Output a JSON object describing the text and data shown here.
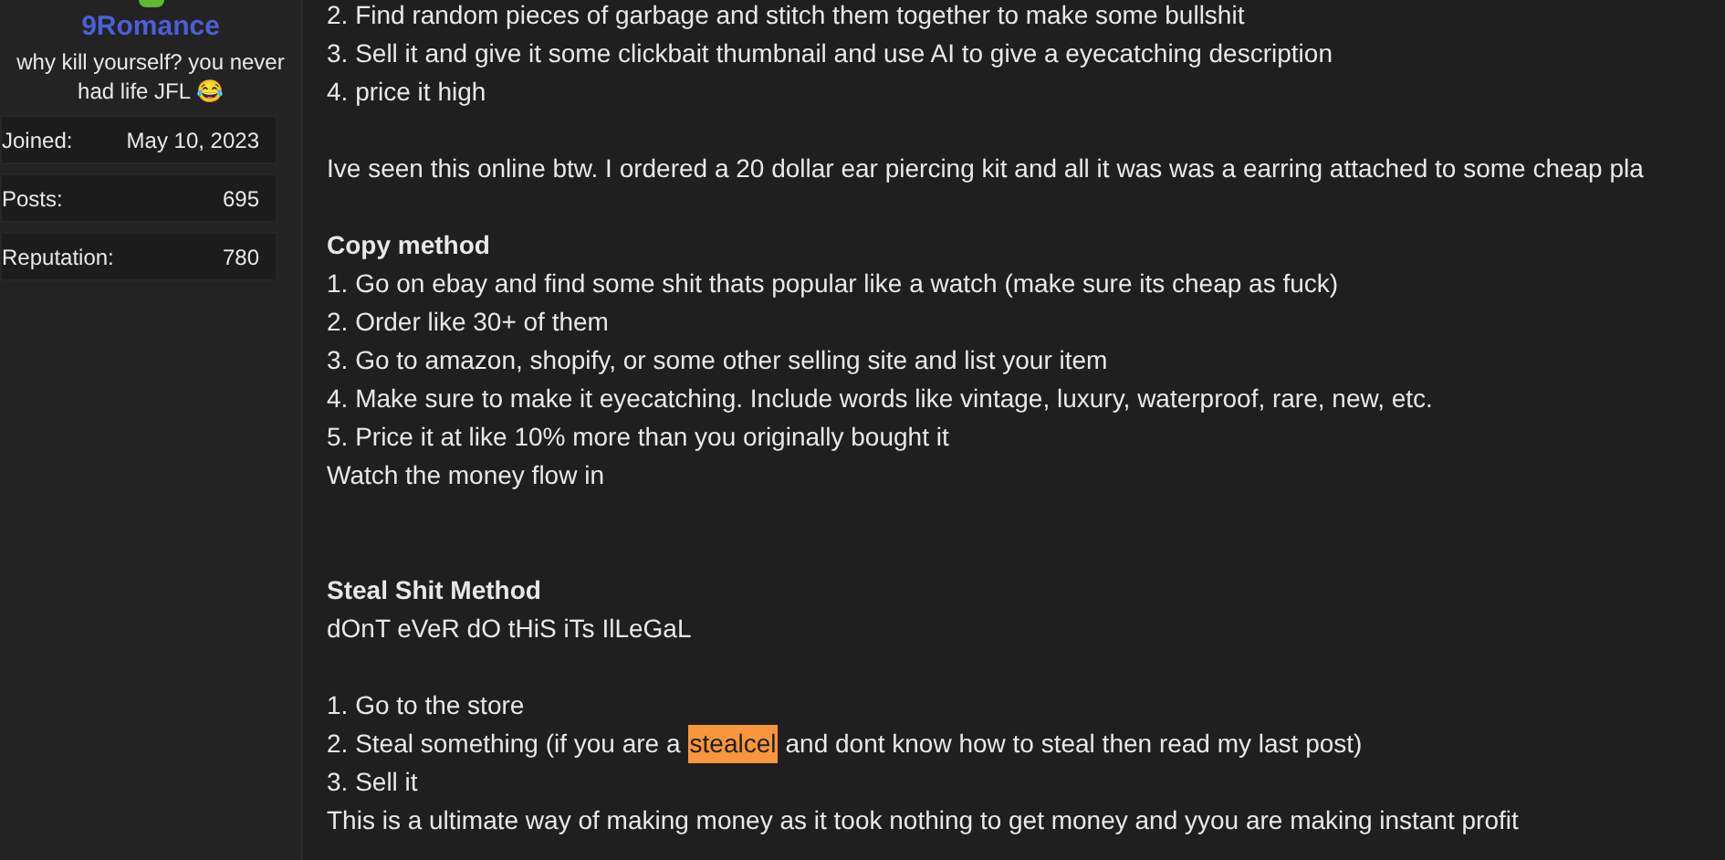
{
  "sidebar": {
    "username": "9Romance",
    "user_title": "why kill yourself? you never had life JFL 😂",
    "stats": [
      {
        "label": "Joined:",
        "value": "May 10, 2023"
      },
      {
        "label": "Posts:",
        "value": "695"
      },
      {
        "label": "Reputation:",
        "value": "780"
      }
    ]
  },
  "post": {
    "lines": [
      {
        "kind": "text",
        "text": "2. Find random pieces of garbage and stitch them together to make some bullshit"
      },
      {
        "kind": "text",
        "text": "3. Sell it and give it some clickbait thumbnail and use AI to give a eyecatching description"
      },
      {
        "kind": "text",
        "text": "4. price it high"
      },
      {
        "kind": "blank"
      },
      {
        "kind": "text",
        "text": "Ive seen this online btw. I ordered a 20 dollar ear piercing kit and all it was was a earring attached to some cheap pla"
      },
      {
        "kind": "blank"
      },
      {
        "kind": "heading",
        "text": "Copy method"
      },
      {
        "kind": "text",
        "text": "1. Go on ebay and find some shit thats popular like a watch (make sure its cheap as fuck)"
      },
      {
        "kind": "text",
        "text": "2. Order like 30+ of them"
      },
      {
        "kind": "text",
        "text": "3. Go to amazon, shopify, or some other selling site and list your item"
      },
      {
        "kind": "text",
        "text": "4. Make sure to make it eyecatching. Include words like vintage, luxury, waterproof, rare, new, etc."
      },
      {
        "kind": "text",
        "text": "5. Price it at like 10% more than you originally bought it"
      },
      {
        "kind": "text",
        "text": "Watch the money flow in"
      },
      {
        "kind": "blank"
      },
      {
        "kind": "blank"
      },
      {
        "kind": "heading",
        "text": "Steal Shit Method"
      },
      {
        "kind": "text",
        "text": "dOnT eVeR dO tHiS iTs IlLeGaL"
      },
      {
        "kind": "blank"
      },
      {
        "kind": "text",
        "text": "1. Go to the store"
      },
      {
        "kind": "segments",
        "segments": [
          {
            "text": "2. Steal something (if you are a",
            "highlighted": false
          },
          {
            "text": "stealcel",
            "highlighted": true
          },
          {
            "text": "and dont know how to steal then read my last post)",
            "highlighted": false
          }
        ]
      },
      {
        "kind": "text",
        "text": "3. Sell it"
      },
      {
        "kind": "text",
        "text": "This is a ultimate way of making money as it took nothing to get money and yyou are making instant profit"
      }
    ]
  }
}
